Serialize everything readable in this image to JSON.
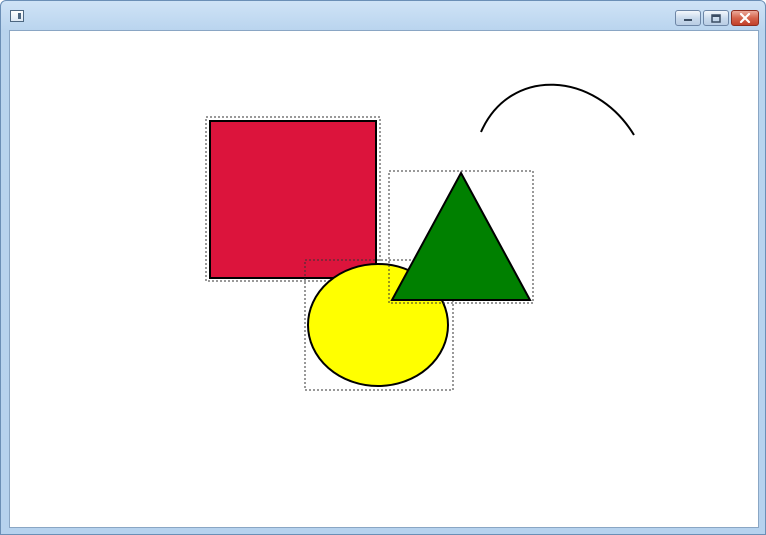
{
  "window": {
    "title": "",
    "icons": {
      "app": "window-app-icon",
      "minimize": "minimize-icon",
      "maximize": "maximize-icon",
      "close": "close-icon"
    }
  },
  "shapes": [
    {
      "name": "rectangle",
      "fill": "#DC143C",
      "selected": true
    },
    {
      "name": "ellipse",
      "fill": "#FFFF00",
      "selected": true
    },
    {
      "name": "triangle",
      "fill": "#008000",
      "selected": true
    },
    {
      "name": "arc",
      "fill": "none",
      "selected": false
    }
  ],
  "colors": {
    "outline": "#000000",
    "selection_outline": "#333333",
    "canvas_background": "#FFFFFF"
  }
}
